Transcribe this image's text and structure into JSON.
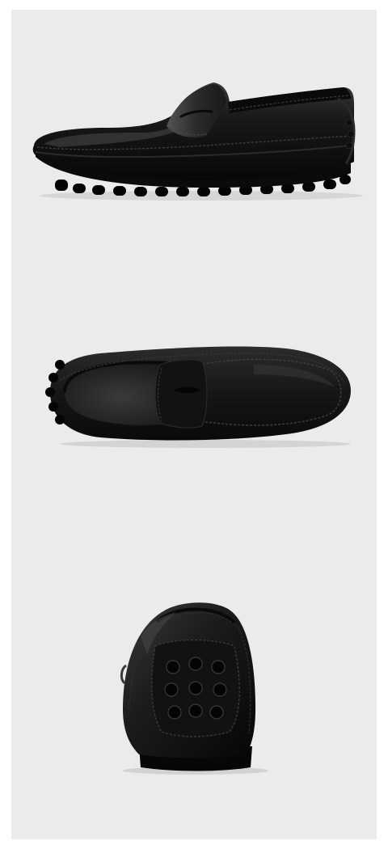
{
  "page": {
    "background_color": "#ffffff",
    "panel_color": "#ebebeb"
  },
  "product": {
    "leather_color": "#141414",
    "sole_color": "#0a0a0a",
    "lining_color": "#2a2a2a"
  },
  "views": [
    {
      "id": "side",
      "icon": "loafer-side-view"
    },
    {
      "id": "top",
      "icon": "loafer-top-view"
    },
    {
      "id": "back",
      "icon": "loafer-heel-view"
    }
  ]
}
